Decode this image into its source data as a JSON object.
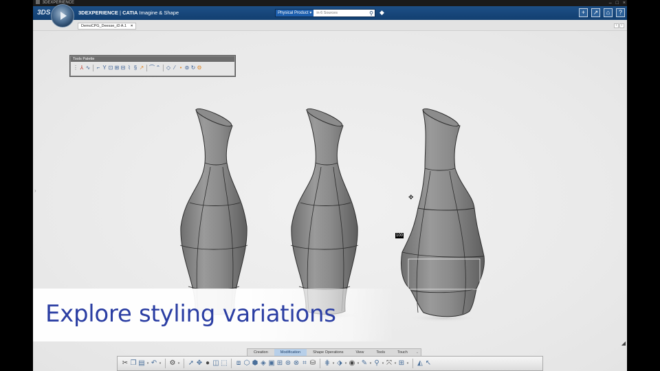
{
  "os_title": "3DEXPERIENCE",
  "topbar": {
    "brand_prefix": "3DEXPERIENCE",
    "brand_app": "CATIA",
    "brand_role": "Imagine & Shape",
    "search": {
      "context": "Physical Product ▾",
      "placeholder": "in 6 Sources"
    },
    "icons": [
      "add-icon",
      "share-icon",
      "home-icon",
      "help-icon"
    ]
  },
  "document_tab": {
    "label": "DemoCPG_Deesse_iD A.1"
  },
  "tools_palette": {
    "title": "Tools Palette"
  },
  "command_tabs": [
    "Creation",
    "Modification",
    "Shape Operations",
    "View",
    "Tools",
    "Touch"
  ],
  "active_command_tab": "Modification",
  "viewport": {
    "dimension_label": "100"
  },
  "overlay": {
    "caption": "Explore styling variations"
  },
  "colors": {
    "brand_blue": "#123f70",
    "caption": "#2b3ea3",
    "active_tab": "#b7cfe9"
  }
}
